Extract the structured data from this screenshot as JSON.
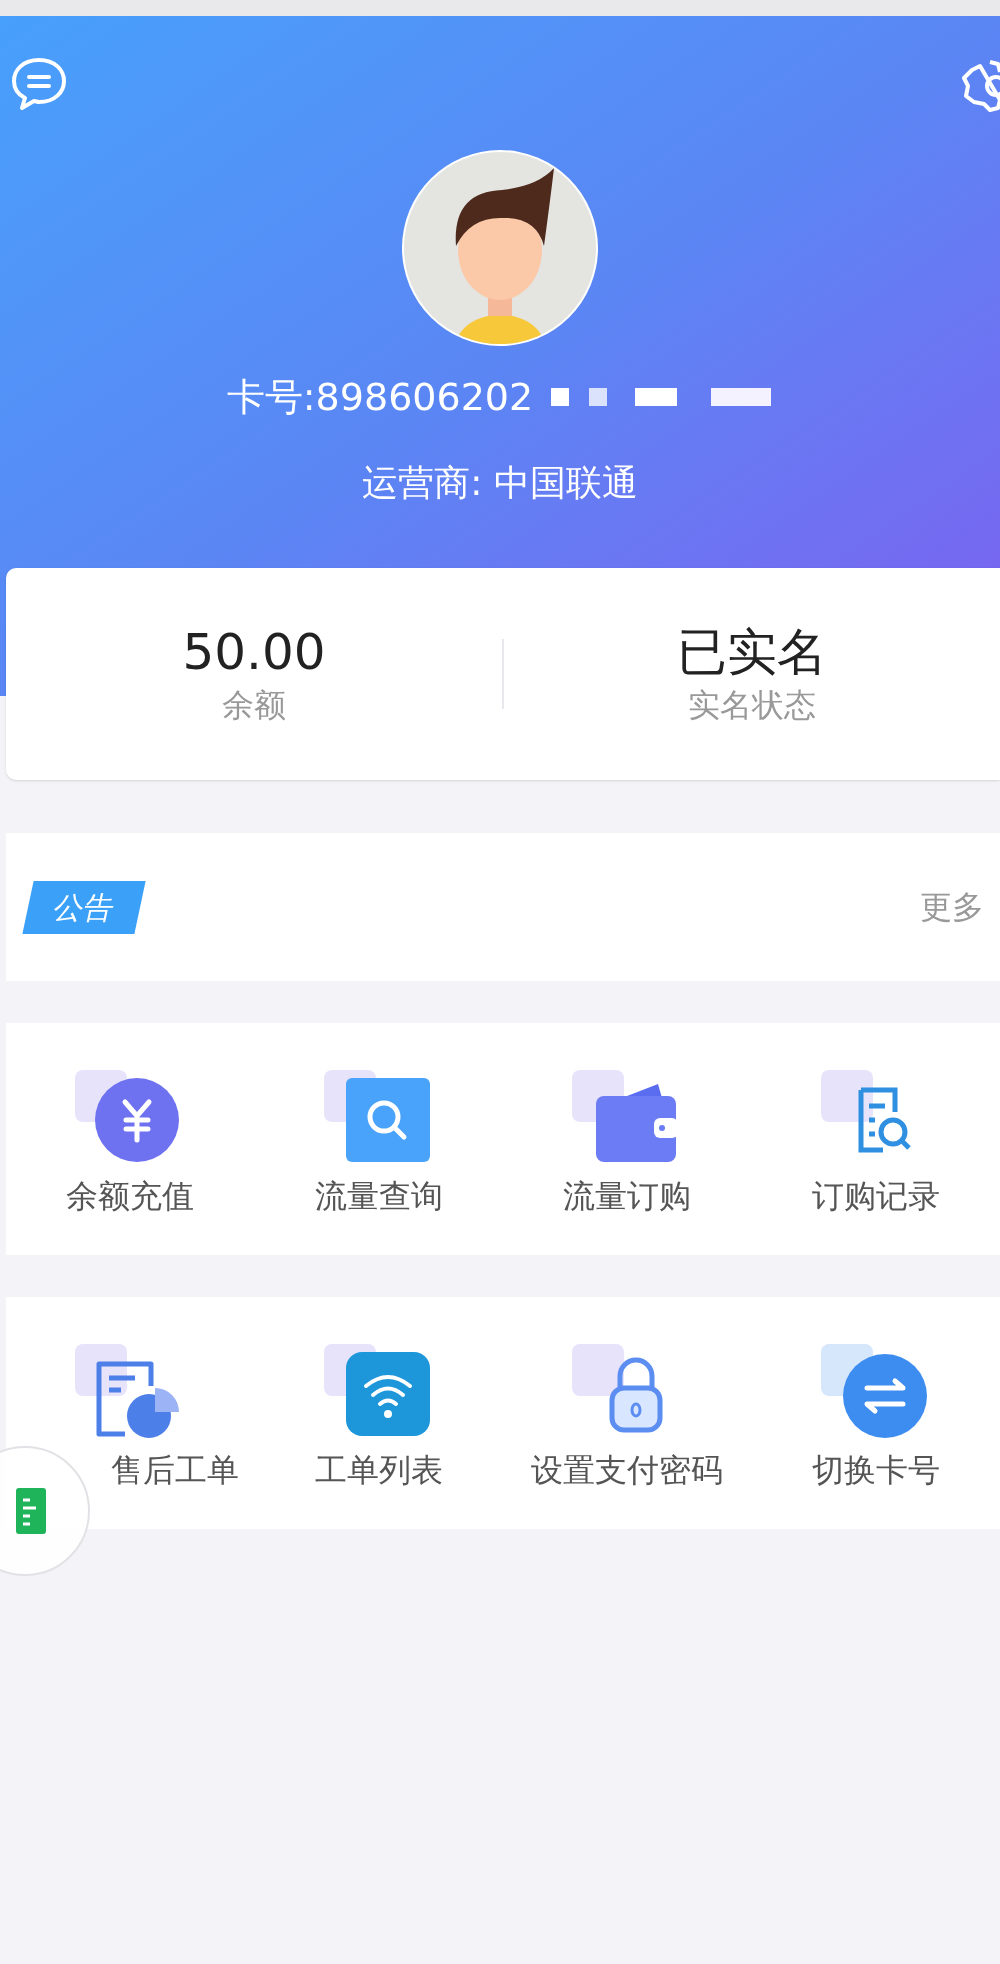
{
  "header": {
    "card_number": "卡号:898606202",
    "operator": "运营商: 中国联通"
  },
  "summary": [
    {
      "value": "50.00",
      "label": "余额"
    },
    {
      "value": "已实名",
      "label": "实名状态"
    }
  ],
  "notice": {
    "tag": "公告",
    "more": "更多"
  },
  "menus": [
    [
      {
        "kind": "yuan",
        "label": "余额充值"
      },
      {
        "kind": "search",
        "label": "流量查询"
      },
      {
        "kind": "wallet",
        "label": "流量订购"
      },
      {
        "kind": "record",
        "label": "订购记录"
      }
    ],
    [
      {
        "kind": "ticket",
        "label": "售后工单"
      },
      {
        "kind": "wifi",
        "label": "工单列表"
      },
      {
        "kind": "lock",
        "label": "设置支付密码"
      },
      {
        "kind": "swap",
        "label": "切换卡号"
      }
    ]
  ]
}
